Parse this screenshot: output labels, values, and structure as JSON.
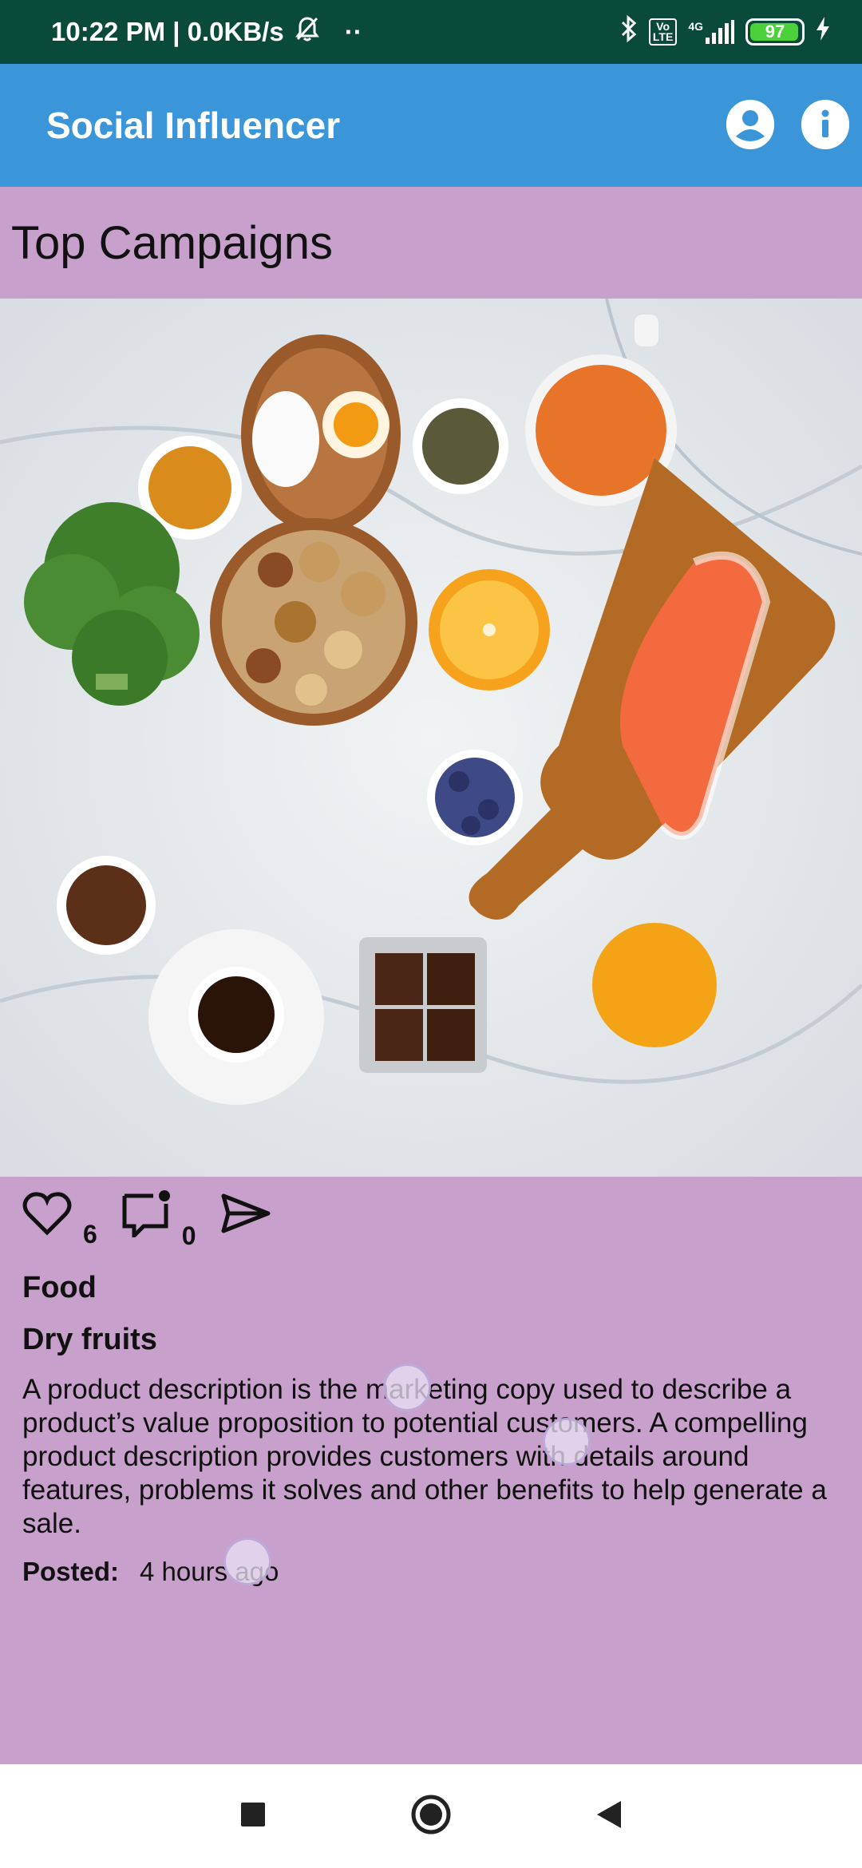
{
  "status_bar": {
    "time": "10:22 PM | 0.0KB/s",
    "volte_label": "Vo\nLTE",
    "network_label": "4G",
    "battery_level": "97",
    "battery_fraction": 0.97
  },
  "app_bar": {
    "title": "Social Influencer",
    "actions": [
      "account-icon",
      "info-icon"
    ]
  },
  "section": {
    "title": "Top Campaigns"
  },
  "post": {
    "likes": "6",
    "comments": "0",
    "category": "Food",
    "title": "Dry fruits",
    "description": "A product description is the marketing copy used to describe a product’s value proposition to potential customers. A compelling product description provides customers with details around features, problems it solves and other benefits to help generate a sale.",
    "posted_label": "Posted:",
    "posted_value": "4 hours ago"
  },
  "colors": {
    "status_bar": "#0a4a3a",
    "app_bar": "#3a96d8",
    "page_background": "#c8a0cc"
  }
}
